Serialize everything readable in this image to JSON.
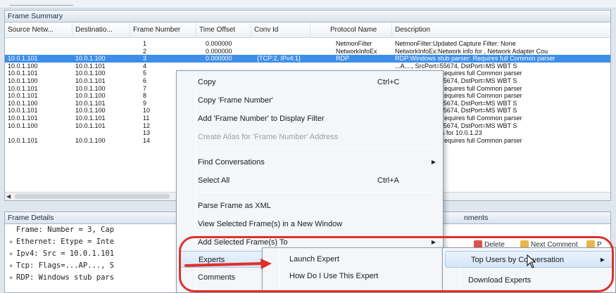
{
  "frame_summary": {
    "title": "Frame Summary",
    "columns": [
      "Source Netw...",
      "Destinatio...",
      "Frame Number",
      "Time Offset",
      "Conv Id",
      "Protocol Name",
      "Description"
    ],
    "rows": [
      {
        "src": "",
        "dst": "",
        "frame": "1",
        "time": "0.000000",
        "conv": "",
        "proto": "NetmonFilter",
        "desc": "NetmonFilter:Updated Capture Filter: None"
      },
      {
        "src": "",
        "dst": "",
        "frame": "2",
        "time": "0.000000",
        "conv": "",
        "proto": "NetworkInfoEx",
        "desc": "NetworkInfoEx:Network info for , Network Adapter Cou"
      },
      {
        "src": "10.0.1.101",
        "dst": "10.0.1.100",
        "frame": "3",
        "time": "0.000000",
        "conv": "{TCP:2, IPv4:1}",
        "proto": "RDP",
        "desc": "RDP:Windows stub parser: Requires full Common parser",
        "selected": true
      },
      {
        "src": "10.0.1.100",
        "dst": "10.0.1.101",
        "frame": "4",
        "time": "",
        "conv": "",
        "proto": "",
        "desc": "...A...., SrcPort=55674, DstPort=MS WBT S"
      },
      {
        "src": "10.0.1.101",
        "dst": "10.0.1.100",
        "frame": "5",
        "time": "",
        "conv": "",
        "proto": "",
        "desc": "ws stub parser: Requires full Common parser"
      },
      {
        "src": "10.0.1.100",
        "dst": "10.0.1.101",
        "frame": "6",
        "time": "",
        "conv": "",
        "proto": "",
        "desc": "...A...., SrcPort=55674, DstPort=MS WBT S"
      },
      {
        "src": "10.0.1.101",
        "dst": "10.0.1.100",
        "frame": "7",
        "time": "",
        "conv": "",
        "proto": "",
        "desc": "ws stub parser: Requires full Common parser"
      },
      {
        "src": "10.0.1.101",
        "dst": "10.0.1.100",
        "frame": "8",
        "time": "",
        "conv": "",
        "proto": "",
        "desc": "ws stub parser: Requires full Common parser"
      },
      {
        "src": "10.0.1.100",
        "dst": "10.0.1.101",
        "frame": "9",
        "time": "",
        "conv": "",
        "proto": "",
        "desc": "...A...., SrcPort=55674, DstPort=MS WBT S"
      },
      {
        "src": "10.0.1.101",
        "dst": "10.0.1.100",
        "frame": "10",
        "time": "",
        "conv": "",
        "proto": "",
        "desc": "...A...., SrcPort=55674, DstPort=MS WBT S"
      },
      {
        "src": "10.0.1.101",
        "dst": "10.0.1.101",
        "frame": "11",
        "time": "",
        "conv": "",
        "proto": "",
        "desc": "ws stub parser: Requires full Common parser"
      },
      {
        "src": "10.0.1.100",
        "dst": "10.0.1.101",
        "frame": "12",
        "time": "",
        "conv": "",
        "proto": "",
        "desc": "...A...., SrcPort=55674, DstPort=MS WBT S"
      },
      {
        "src": "",
        "dst": "",
        "frame": "13",
        "time": "",
        "conv": "",
        "proto": "",
        "desc": "st, 10.0.1.26 asks for 10.0.1.23"
      },
      {
        "src": "10.0.1.101",
        "dst": "10.0.1.100",
        "frame": "14",
        "time": "",
        "conv": "",
        "proto": "",
        "desc": "ws stub parser: Requires full Common parser"
      }
    ]
  },
  "frame_details": {
    "title": "Frame Details",
    "lines": [
      {
        "toggle": "",
        "text": "Frame: Number = 3, Cap"
      },
      {
        "toggle": "+",
        "text": "Ethernet: Etype = Inte"
      },
      {
        "toggle": "+",
        "text": "Ipv4: Src = 10.0.1.101"
      },
      {
        "toggle": "+",
        "text": "Tcp: Flags=...AP..., S"
      },
      {
        "toggle": "+",
        "text": "RDP: Windows stub pars"
      }
    ]
  },
  "comments_pane": {
    "title": "nments",
    "toolbar": {
      "delete": "Delete",
      "next_comment": "Next Comment",
      "prev": "P"
    }
  },
  "context_menu": {
    "items": [
      {
        "label": "Copy",
        "shortcut": "Ctrl+C"
      },
      {
        "label": "Copy 'Frame Number'"
      },
      {
        "label": "Add 'Frame Number' to Display Filter"
      },
      {
        "label": "Create Alias for 'Frame Number' Address",
        "disabled": true
      },
      {
        "label": "Find Conversations",
        "submenu": true
      },
      {
        "label": "Select All",
        "shortcut": "Ctrl+A"
      },
      {
        "label": "Parse Frame as XML"
      },
      {
        "label": "View Selected Frame(s) in a New Window"
      },
      {
        "label": "Add Selected Frame(s) To",
        "submenu": true
      },
      {
        "label": "Experts",
        "submenu": true
      },
      {
        "label": "Comments"
      }
    ]
  },
  "experts_submenu": {
    "items": [
      {
        "label": "Launch Expert"
      },
      {
        "label": "How Do I Use This Expert"
      }
    ]
  },
  "launch_submenu": {
    "items": [
      {
        "label": "Top Users by Conversation",
        "submenu": true
      },
      {
        "label": "Download Experts"
      }
    ]
  },
  "glyphs": {
    "submenu_arrow": "▶",
    "expand": "+"
  },
  "colors": {
    "selection": "#3d8ee8",
    "annotation": "#e0302a",
    "menu_hover": "#d5e6f8"
  }
}
